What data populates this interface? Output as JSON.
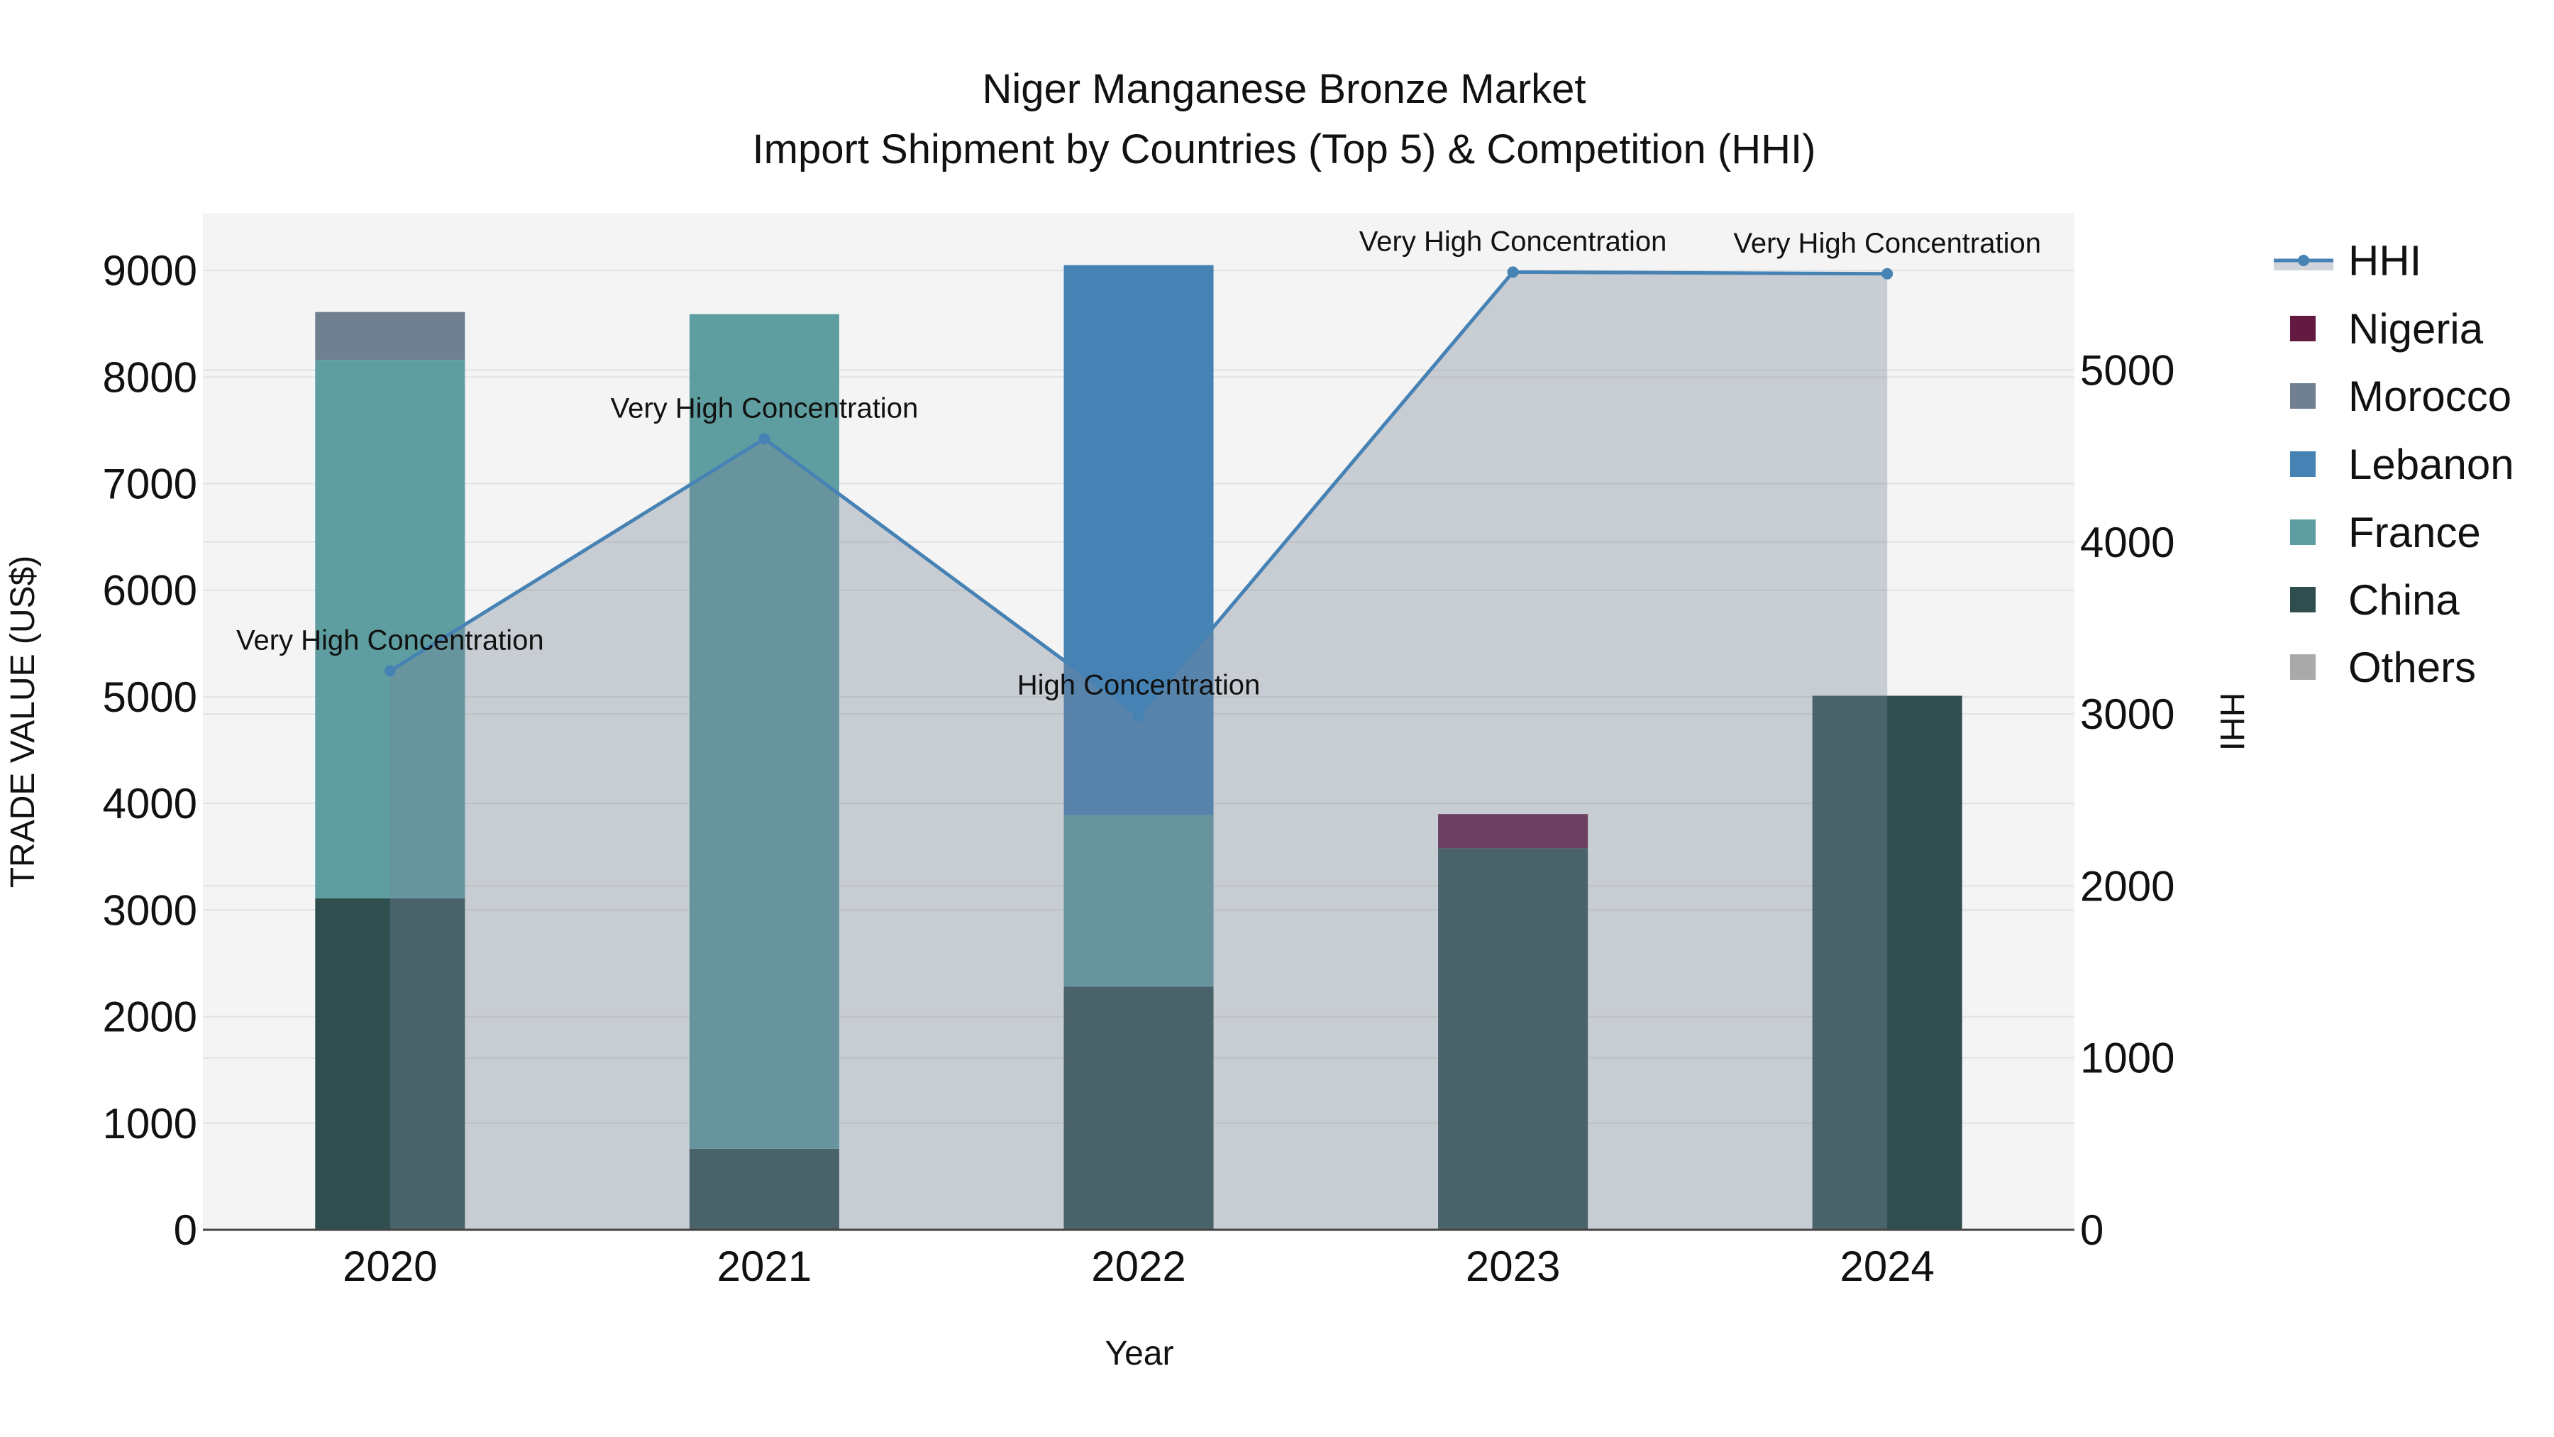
{
  "chart_data": {
    "type": "bar",
    "title": "Niger Manganese Bronze Market",
    "subtitle": "Import Shipment by Countries (Top 5) & Competition (HHI)",
    "xlabel": "Year",
    "ylabel": "TRADE VALUE (US$)",
    "y2label": "HHI",
    "categories": [
      "2020",
      "2021",
      "2022",
      "2023",
      "2024"
    ],
    "ylim": [
      0,
      9540
    ],
    "y2lim": [
      0,
      5914
    ],
    "yticks": [
      0,
      1000,
      2000,
      3000,
      4000,
      5000,
      6000,
      7000,
      8000,
      9000
    ],
    "y2ticks": [
      0,
      1000,
      2000,
      3000,
      4000,
      5000
    ],
    "grid": true,
    "barmode": "stack",
    "legend_position": "right",
    "series": [
      {
        "name": "China",
        "color": "#2f4f4f",
        "values": [
          3110,
          760,
          2280,
          3580,
          5010
        ]
      },
      {
        "name": "France",
        "color": "#5f9ea0",
        "values": [
          5050,
          7830,
          1610,
          0,
          0
        ]
      },
      {
        "name": "Lebanon",
        "color": "#4682b4",
        "values": [
          0,
          0,
          5160,
          0,
          0
        ]
      },
      {
        "name": "Morocco",
        "color": "#708090",
        "values": [
          450,
          0,
          0,
          0,
          0
        ]
      },
      {
        "name": "Nigeria",
        "color": "#641a40",
        "values": [
          0,
          0,
          0,
          320,
          0
        ]
      },
      {
        "name": "Others",
        "color": "#a9a9a9",
        "values": [
          0,
          0,
          0,
          0,
          0
        ]
      }
    ],
    "hhi": {
      "name": "HHI",
      "color": "#4682b4",
      "values": [
        3250,
        4600,
        2990,
        5570,
        5560
      ],
      "annotations": [
        "Very High Concentration",
        "Very High Concentration",
        "High Concentration",
        "Very High Concentration",
        "Very High Concentration"
      ]
    },
    "legend": [
      "HHI",
      "Nigeria",
      "Morocco",
      "Lebanon",
      "France",
      "China",
      "Others"
    ]
  }
}
